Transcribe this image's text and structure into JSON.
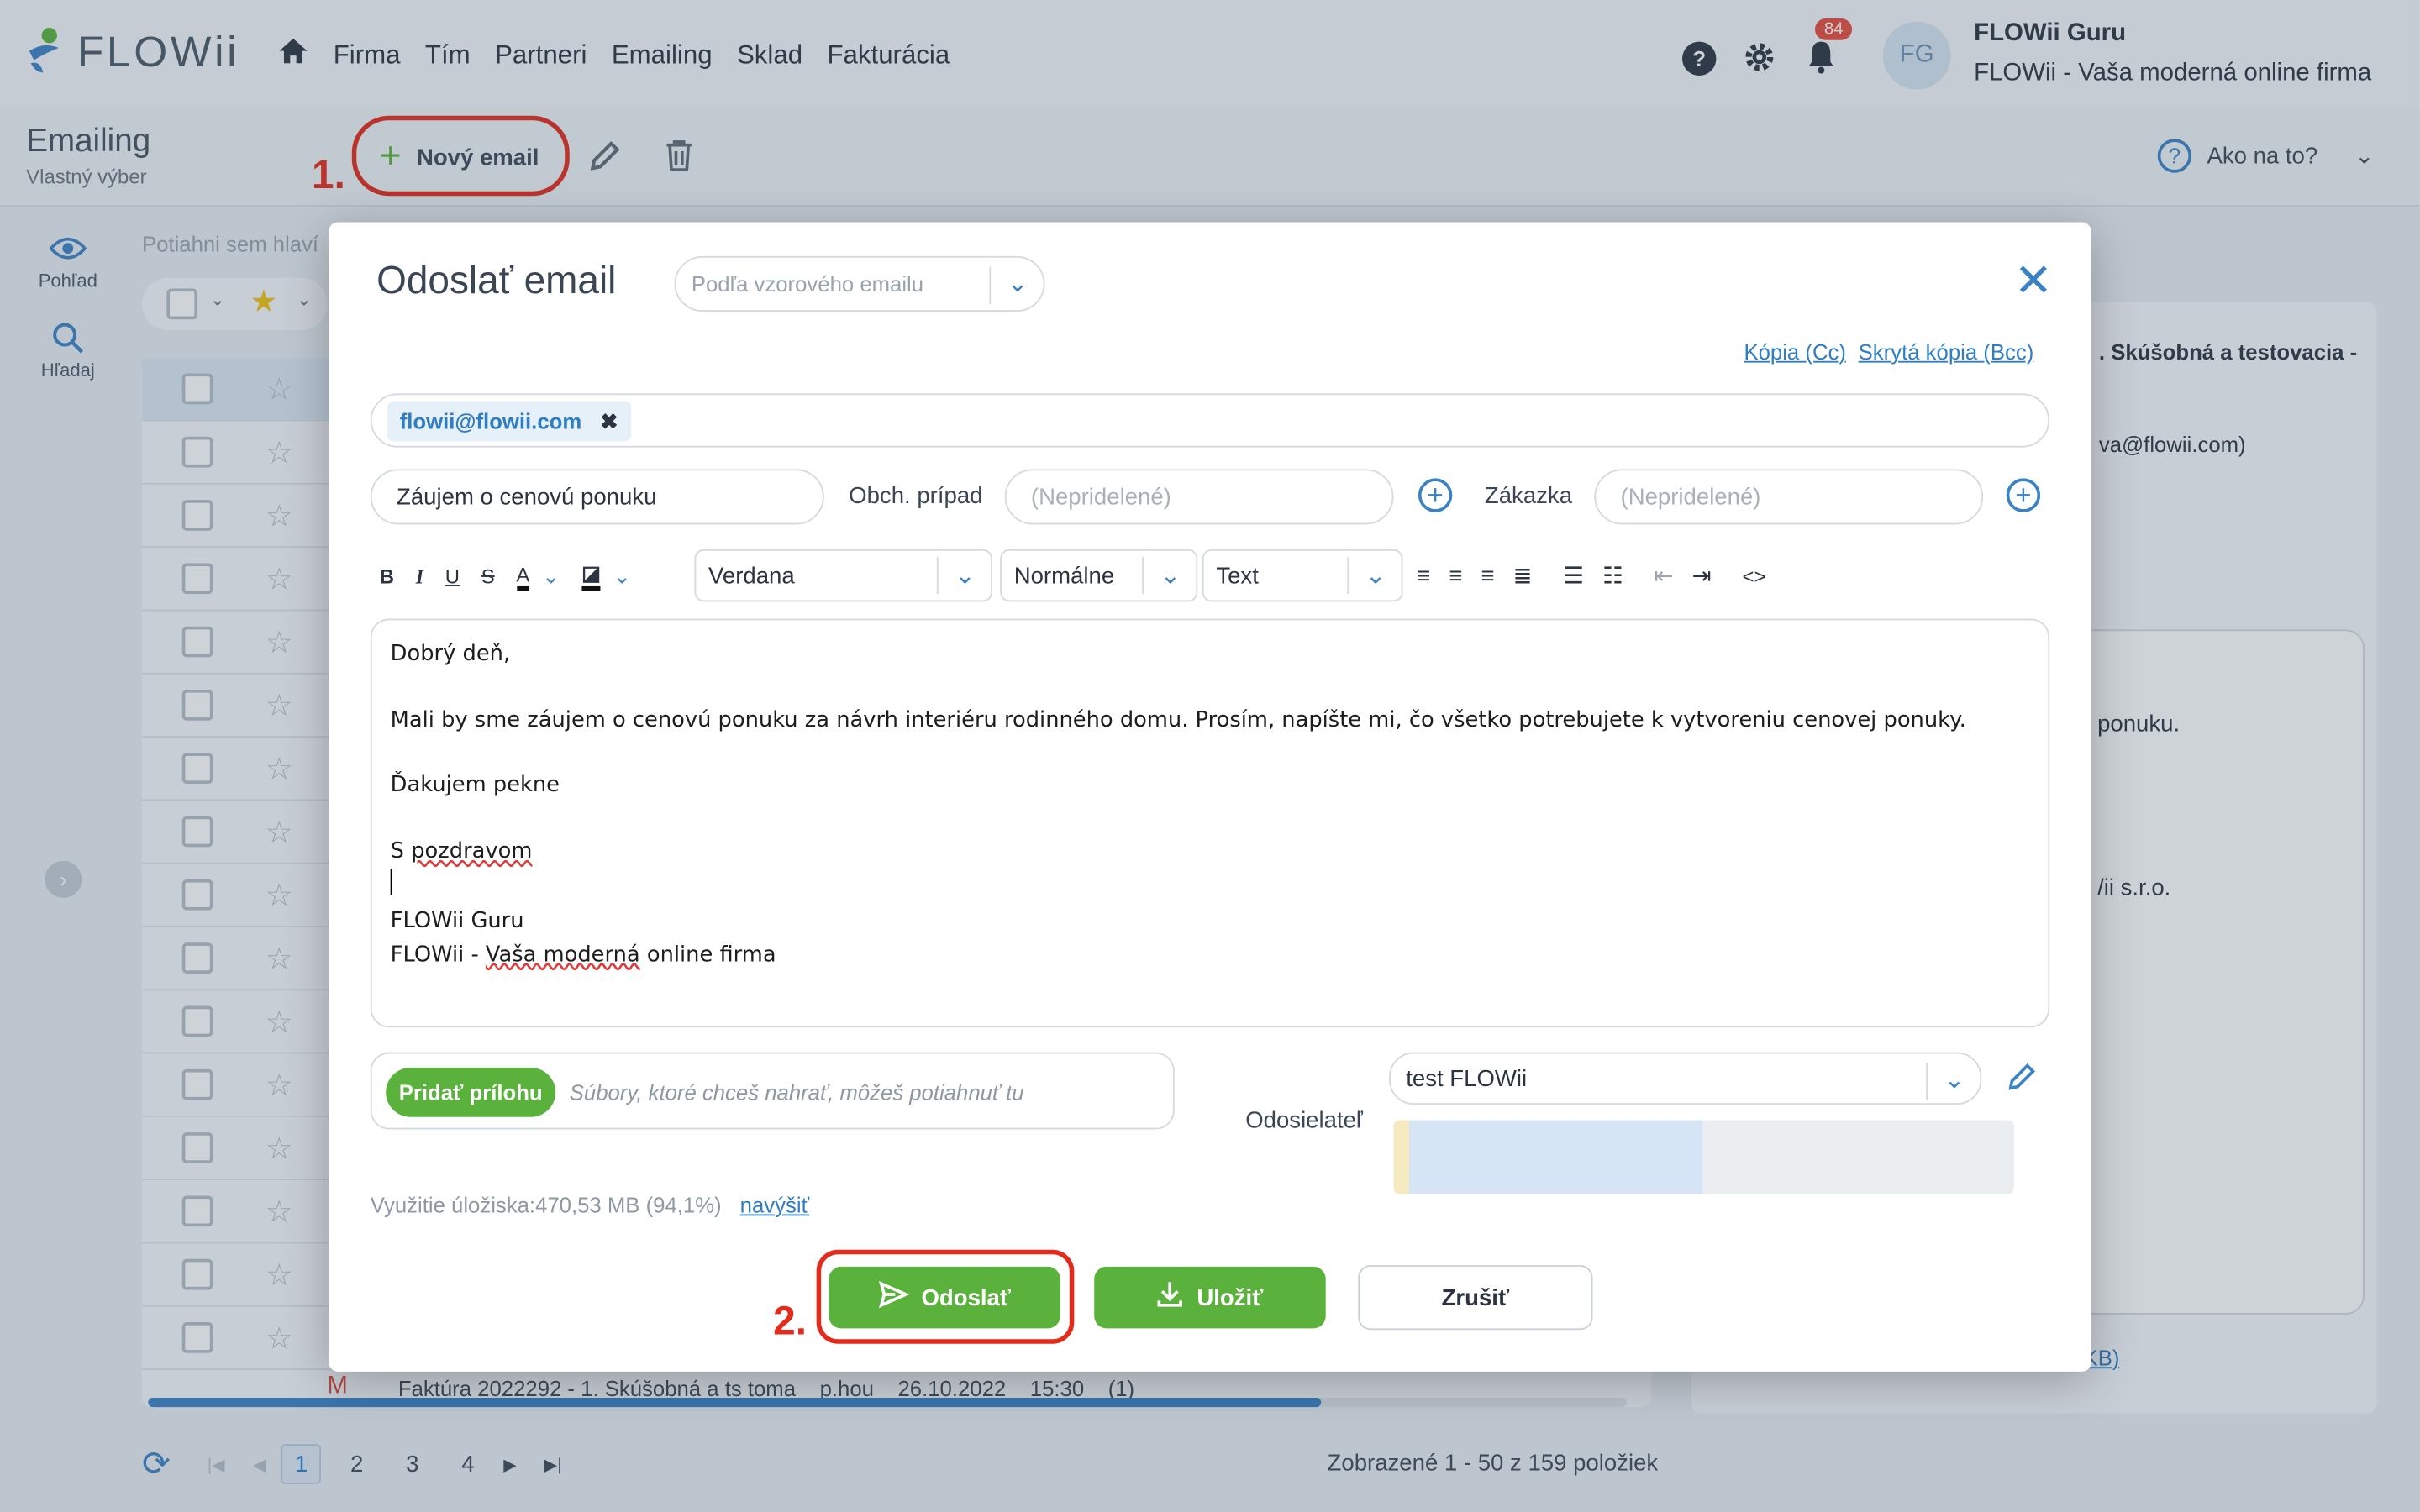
{
  "app": {
    "logo_text": "FLOWii",
    "nav": [
      "Firma",
      "Tím",
      "Partneri",
      "Emailing",
      "Sklad",
      "Fakturácia"
    ],
    "notifications_count": "84",
    "avatar_initials": "FG",
    "user_name": "FLOWii Guru",
    "user_company": "FLOWii - Vaša moderná online firma"
  },
  "subheader": {
    "title": "Emailing",
    "subtitle": "Vlastný výber",
    "new_email_label": "Nový email",
    "step1": "1.",
    "help_label": "Ako na to?"
  },
  "rail": {
    "view_label": "Pohľad",
    "search_label": "Hľadaj"
  },
  "list": {
    "drag_hint": "Potiahni sem hlaví",
    "last_row": "Faktúra 2022292 - 1. Skúšobná a ts toma    p.hou    26.10.2022    15:30    (1)"
  },
  "right_panel": {
    "subject_fragment": ". Skúšobná a testovacia -",
    "email_fragment": "va@flowii.com)",
    "body_fragment_1": "ponuku.",
    "body_fragment_2": "/ii s.r.o.",
    "attach_fragment": "KB)"
  },
  "modal": {
    "title": "Odoslať email",
    "template_placeholder": "Podľa vzorového emailu",
    "cc_label": "Kópia (Cc)",
    "bcc_label": "Skrytá kópia (Bcc)",
    "recipient": "flowii@flowii.com",
    "subject": "Záujem o cenovú ponuku",
    "case_label": "Obch. prípad",
    "case_placeholder": "(Nepridelené)",
    "order_label": "Zákazka",
    "order_placeholder": "(Nepridelené)",
    "toolbar": {
      "font": "Verdana",
      "size": "Normálne",
      "format": "Text"
    },
    "body": {
      "greeting": "Dobrý deň,",
      "line1": "Mali by sme záujem o cenovú ponuku za návrh interiéru rodinného domu. Prosím, napíšte mi, čo všetko potrebujete k vytvoreniu cenovej ponuky.",
      "thanks": "Ďakujem pekne",
      "regards_a": "S ",
      "regards_b": "pozdravom",
      "sig_name": "FLOWii Guru",
      "sig_firm_a": "FLOWii - ",
      "sig_firm_b": "Vaša moderná",
      "sig_firm_c": " online firma"
    },
    "attach_button": "Pridať prílohu",
    "attach_hint": "Súbory, ktoré chceš nahrať, môžeš potiahnuť tu",
    "sender_label": "Odosielateľ",
    "sender_value": "test FLOWii",
    "storage_text": "Využitie úložiska:470,53 MB (94,1%)",
    "storage_link": "navýšiť",
    "send_label": "Odoslať",
    "save_label": "Uložiť",
    "cancel_label": "Zrušiť",
    "step2": "2."
  },
  "pager": {
    "pages": [
      "1",
      "2",
      "3",
      "4"
    ],
    "summary": "Zobrazené 1 - 50 z 159 položiek"
  },
  "colors": {
    "accent_blue": "#2f7dc2",
    "green": "#5ab23c",
    "annotation_red": "#e32b1b"
  }
}
